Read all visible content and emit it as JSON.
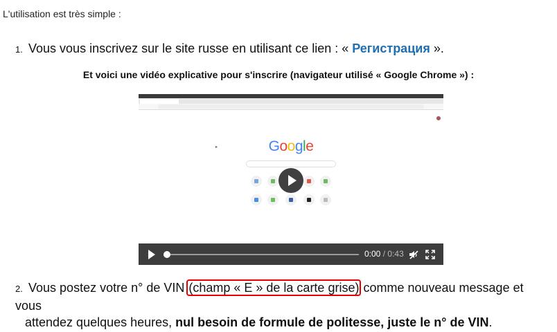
{
  "intro": "L'utilisation est très simple :",
  "step1": {
    "number": "1.",
    "text_before": "Vous vous inscrivez sur le site russe en utilisant ce lien : « ",
    "link": "Регистрация",
    "text_after": " »."
  },
  "subtitle": "Et voici une vidéo explicative pour s'inscrire (navigateur utilisé « Google Chrome ») :",
  "video": {
    "current_time": "0:00",
    "separator": "/",
    "duration": "0:43",
    "progress": 0
  },
  "step2": {
    "number": "2.",
    "text_before": "Vous postez votre n° de VIN ",
    "highlight": "(champ « E » de la carte grise)",
    "text_after": " comme nouveau message et vous",
    "line2_text": "attendez quelques heures, ",
    "line2_bold": "nul besoin de formule de politesse, juste le n° de VIN",
    "line2_end": "."
  },
  "colors": {
    "link": "#1f6fb3",
    "highlight_border": "#e60000",
    "controls_bg": "#3d3d3d"
  }
}
